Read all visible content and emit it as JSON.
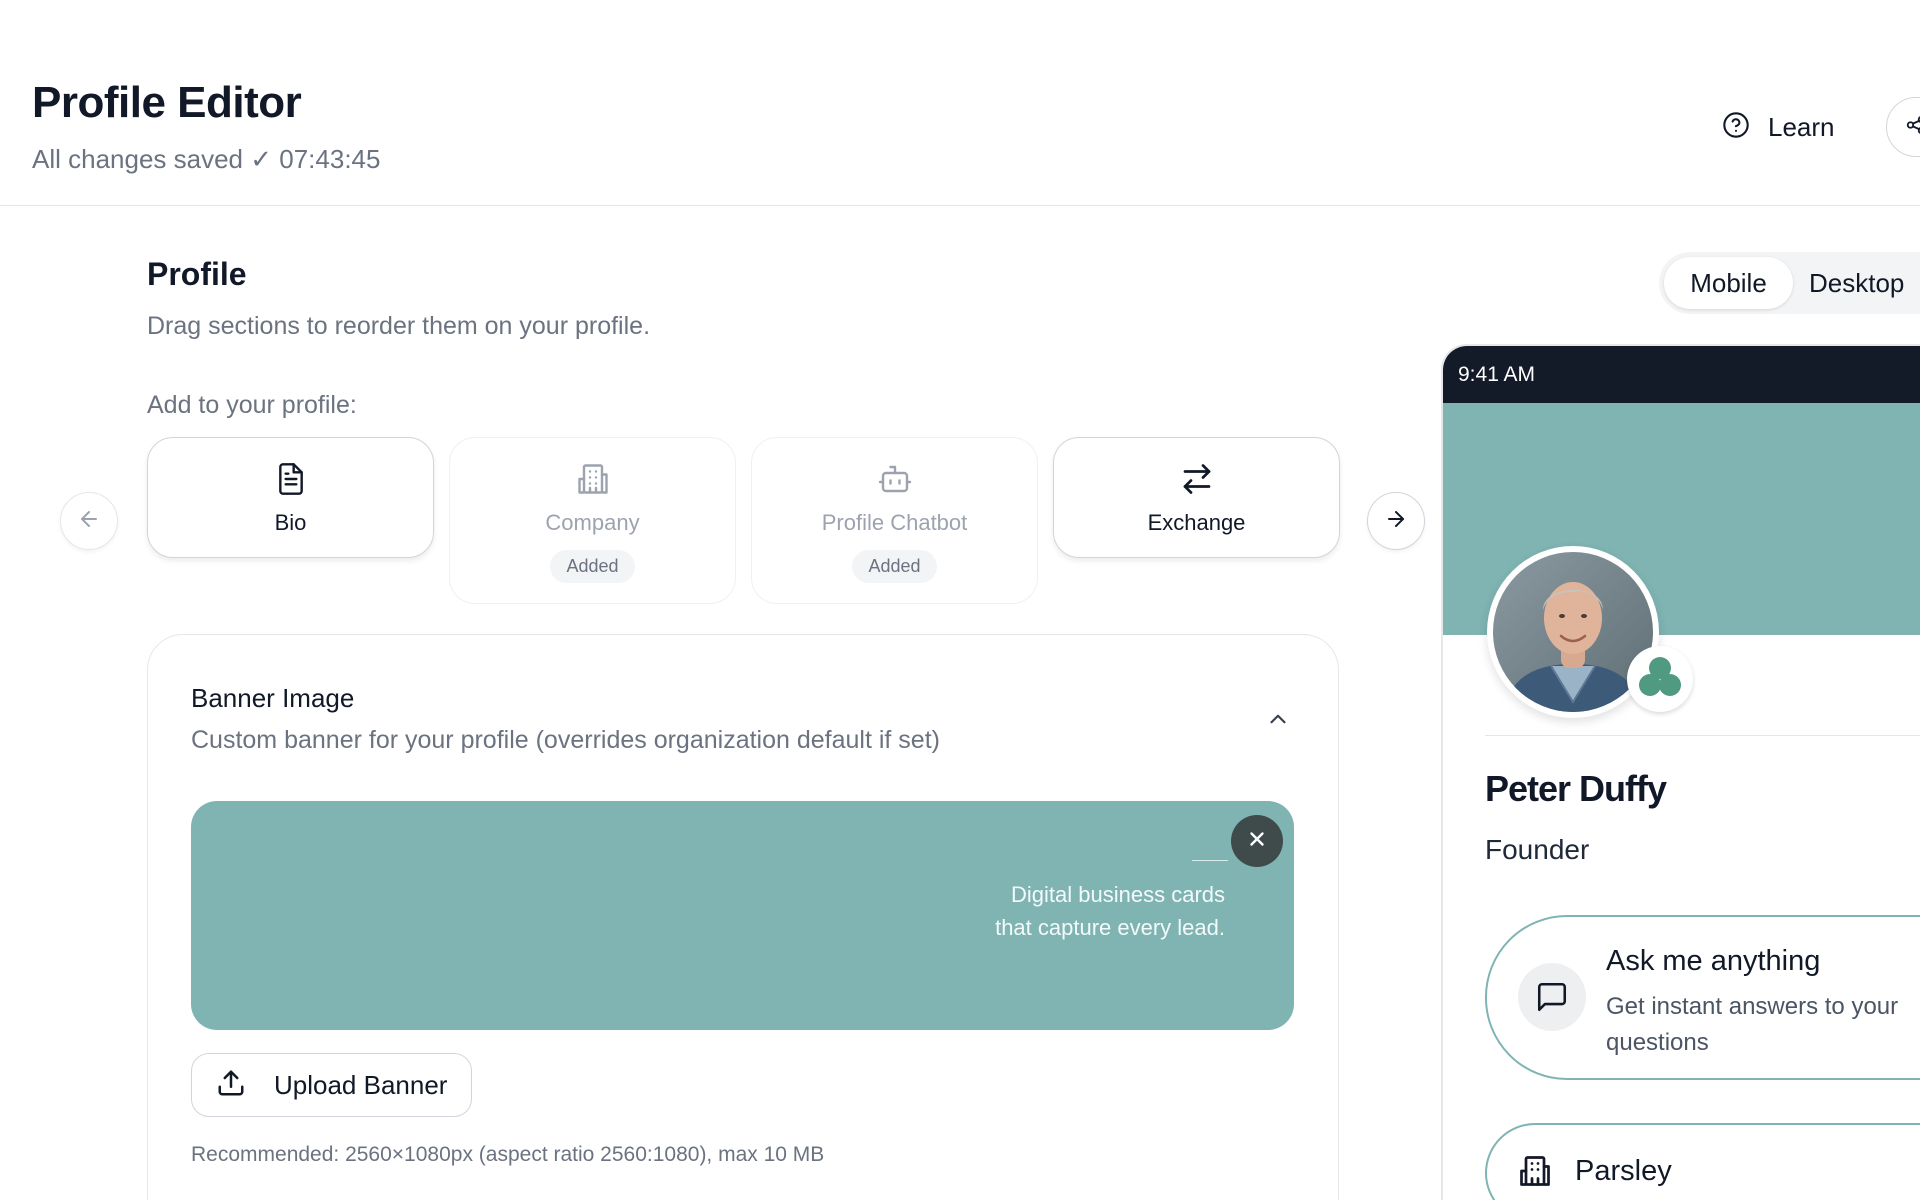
{
  "header": {
    "title": "Profile Editor",
    "save_status": "All changes saved ✓ 07:43:45",
    "learn_label": "Learn",
    "learn_icon": "help-circle-icon",
    "share_icon": "share-icon"
  },
  "editor": {
    "section_title": "Profile",
    "section_subtitle": "Drag sections to reorder them on your profile.",
    "add_label": "Add to your profile:",
    "cards": [
      {
        "label": "Bio",
        "icon": "document-icon",
        "state": "available"
      },
      {
        "label": "Company",
        "icon": "building-icon",
        "state": "added",
        "badge": "Added"
      },
      {
        "label": "Profile Chatbot",
        "icon": "bot-icon",
        "state": "added",
        "badge": "Added"
      },
      {
        "label": "Exchange",
        "icon": "exchange-icon",
        "state": "available"
      }
    ],
    "banner": {
      "title": "Banner Image",
      "description": "Custom banner for your profile (overrides organization default if set)",
      "preview_line1": "Digital business cards",
      "preview_line2": "that capture every lead.",
      "upload_label": "Upload Banner",
      "hint": "Recommended: 2560×1080px (aspect ratio 2560:1080), max 10 MB"
    }
  },
  "preview": {
    "toggle": {
      "mobile": "Mobile",
      "desktop": "Desktop",
      "selected": "Mobile"
    },
    "status_time": "9:41 AM",
    "name": "Peter Duffy",
    "role": "Founder",
    "chatbot_title": "Ask me anything",
    "chatbot_subtitle": "Get instant answers to your questions",
    "company_name": "Parsley"
  },
  "colors": {
    "accent_teal": "#7fb4b3",
    "status_bar": "#131a28",
    "text_primary": "#111827",
    "text_muted": "#6b7280",
    "logo_green": "#4f9a80"
  }
}
